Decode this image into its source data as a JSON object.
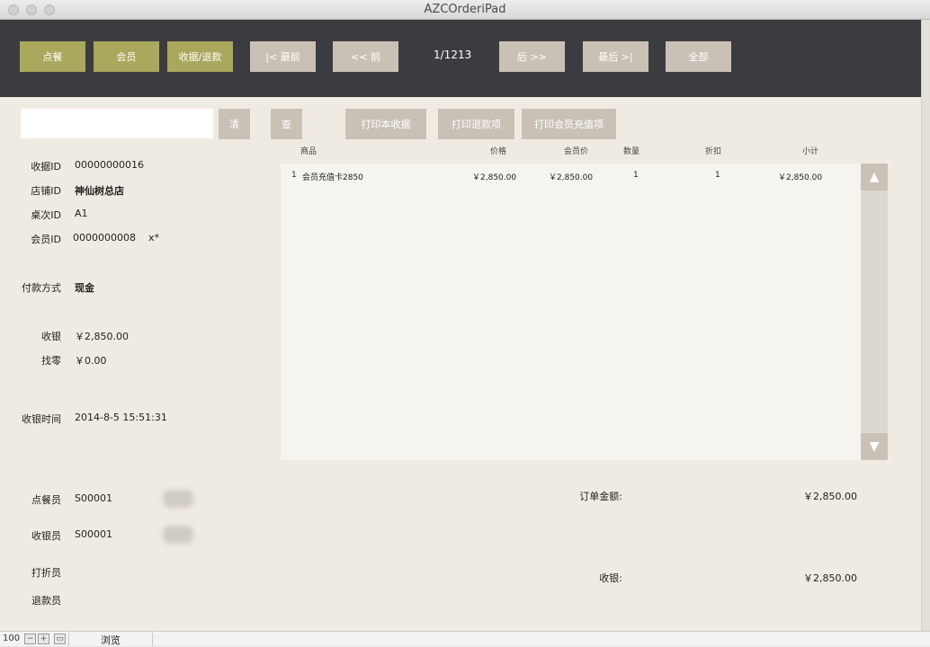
{
  "window": {
    "title": "AZCOrderiPad"
  },
  "toolbar": {
    "order": "点餐",
    "member": "会员",
    "receipt_refund": "收据/退款",
    "first": "|< 最前",
    "prev": "<< 前",
    "page": "1/1213",
    "next": "后 >>",
    "last": "最后 >|",
    "all": "全部"
  },
  "controls": {
    "search_value": "",
    "clear": "清",
    "query": "查",
    "print_receipt": "打印本收据",
    "print_refund": "打印退款项",
    "print_member_topup": "打印会员充值项"
  },
  "receipt": {
    "receipt_id_label": "收据ID",
    "receipt_id": "00000000016",
    "store_id_label": "店铺ID",
    "store_id": "神仙树总店",
    "table_id_label": "桌次ID",
    "table_id": "A1",
    "member_id_label": "会员ID",
    "member_id": "0000000008",
    "member_suffix": "x*",
    "payment_label": "付款方式",
    "payment": "现金",
    "cash_label": "收银",
    "cash": "￥2,850.00",
    "change_label": "找零",
    "change": "￥0.00",
    "time_label": "收银时间",
    "time": "2014-8-5 15:51:31"
  },
  "table": {
    "headers": {
      "item": "商品",
      "price": "价格",
      "member_price": "会员价",
      "qty": "数量",
      "discount": "折扣",
      "subtotal": "小计"
    },
    "rows": [
      {
        "no": "1",
        "item": "会员充值卡2850",
        "price": "￥2,850.00",
        "member_price": "￥2,850.00",
        "qty": "1",
        "discount": "1",
        "subtotal": "￥2,850.00"
      }
    ]
  },
  "staff": {
    "order_staff_label": "点餐员",
    "order_staff": "S00001",
    "cashier_label": "收银员",
    "cashier": "S00001",
    "discount_staff_label": "打折员",
    "refund_staff_label": "退款员"
  },
  "totals": {
    "order_amount_label": "订单金额:",
    "order_amount": "￥2,850.00",
    "cash_label": "收银:",
    "cash": "￥2,850.00"
  },
  "statusbar": {
    "zoom": "100",
    "mode": "浏览"
  }
}
